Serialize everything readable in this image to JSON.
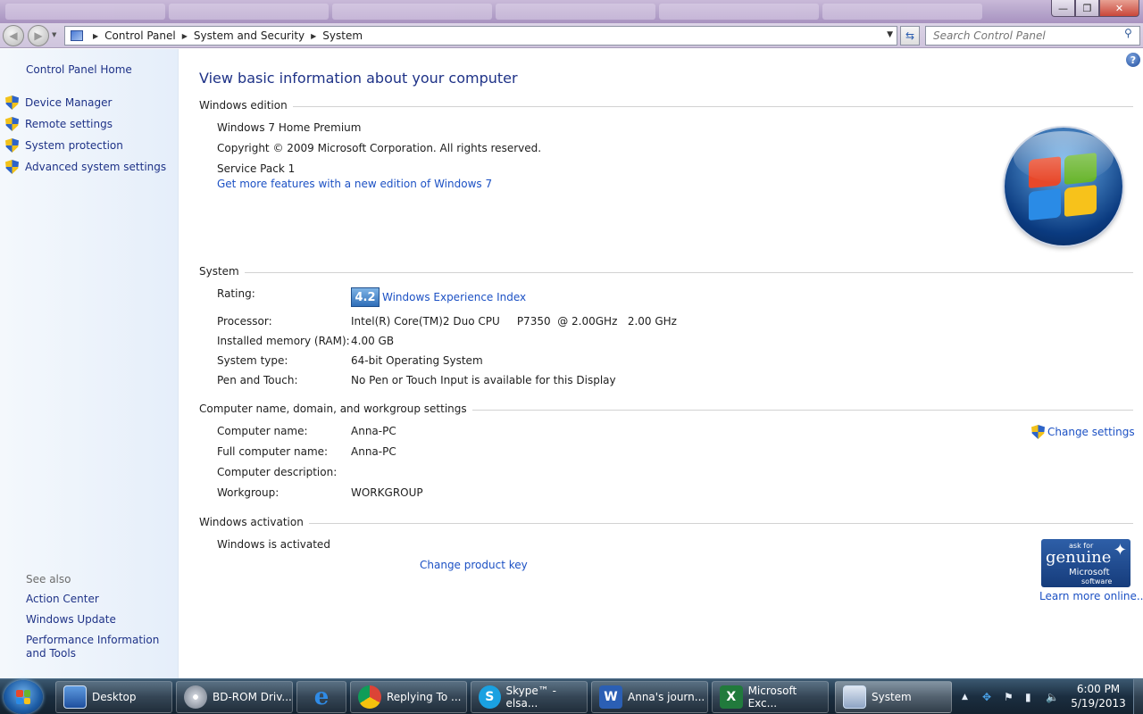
{
  "window": {
    "min_glyph": "—",
    "max_glyph": "❐",
    "close_glyph": "✕"
  },
  "address_bar": {
    "breadcrumbs": [
      "Control Panel",
      "System and Security",
      "System"
    ],
    "search_placeholder": "Search Control Panel"
  },
  "left_pane": {
    "home": "Control Panel Home",
    "tasks": [
      "Device Manager",
      "Remote settings",
      "System protection",
      "Advanced system settings"
    ],
    "see_also_label": "See also",
    "see_also": [
      "Action Center",
      "Windows Update",
      "Performance Information and Tools"
    ]
  },
  "main": {
    "title": "View basic information about your computer",
    "windows_edition": {
      "heading": "Windows edition",
      "edition": "Windows 7 Home Premium",
      "copyright": "Copyright © 2009 Microsoft Corporation.  All rights reserved.",
      "service_pack": "Service Pack 1",
      "upgrade_link": "Get more features with a new edition of Windows 7"
    },
    "system": {
      "heading": "System",
      "rating_label": "Rating:",
      "rating_score": "4.2",
      "rating_link": "Windows Experience Index",
      "processor_label": "Processor:",
      "processor_value": "Intel(R) Core(TM)2 Duo CPU     P7350  @ 2.00GHz   2.00 GHz",
      "memory_label": "Installed memory (RAM):",
      "memory_value": "4.00 GB",
      "type_label": "System type:",
      "type_value": "64-bit Operating System",
      "pen_label": "Pen and Touch:",
      "pen_value": "No Pen or Touch Input is available for this Display"
    },
    "computer_name": {
      "heading": "Computer name, domain, and workgroup settings",
      "change_settings": "Change settings",
      "name_label": "Computer name:",
      "name_value": "Anna-PC",
      "full_label": "Full computer name:",
      "full_value": "Anna-PC",
      "desc_label": "Computer description:",
      "workgroup_label": "Workgroup:",
      "workgroup_value": "WORKGROUP"
    },
    "activation": {
      "heading": "Windows activation",
      "status": "Windows is activated",
      "change_key": "Change product key",
      "learn_more": "Learn more online..."
    },
    "genuine_badge": {
      "line1": "ask for",
      "line2": "genuine",
      "line3": "Microsoft",
      "line4": "software"
    }
  },
  "taskbar": {
    "items": [
      {
        "label": "Desktop",
        "icon": "desktop-icon"
      },
      {
        "label": "BD-ROM Driv...",
        "icon": "cd-rom-icon"
      },
      {
        "label": "",
        "icon": "internet-explorer-icon"
      },
      {
        "label": "Replying To ...",
        "icon": "chrome-icon"
      },
      {
        "label": "Skype™ - elsa...",
        "icon": "skype-icon"
      },
      {
        "label": "Anna's journ...",
        "icon": "word-icon"
      },
      {
        "label": "Microsoft Exc...",
        "icon": "excel-icon"
      },
      {
        "label": "System",
        "icon": "system-icon"
      }
    ],
    "time": "6:00 PM",
    "date": "5/19/2013"
  }
}
